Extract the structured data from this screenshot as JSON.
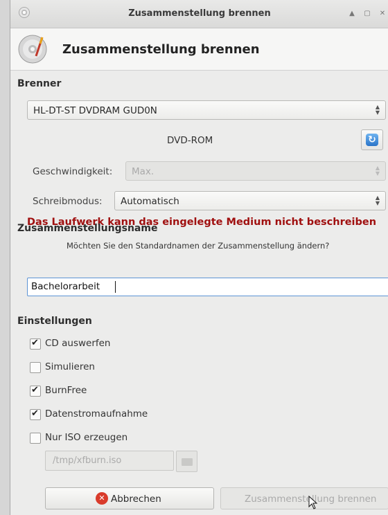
{
  "window": {
    "title": "Zusammenstellung brennen"
  },
  "header": {
    "title": "Zusammenstellung brennen"
  },
  "burner": {
    "section_label": "Brenner",
    "drive": "HL-DT-ST DVDRAM GUD0N",
    "media": "DVD-ROM",
    "speed_label": "Geschwindigkeit:",
    "speed_value": "Max.",
    "mode_label": "Schreibmodus:",
    "mode_value": "Automatisch",
    "error": "Das Laufwerk kann das eingelegte Medium nicht beschreiben"
  },
  "composition": {
    "section_label": "Zusammenstellungsname",
    "hint": "Möchten Sie den Standardnamen der Zusammenstellung ändern?",
    "name": "Bachelorarbeit"
  },
  "settings": {
    "section_label": "Einstellungen",
    "options": [
      {
        "label": "CD auswerfen",
        "checked": true
      },
      {
        "label": "Simulieren",
        "checked": false
      },
      {
        "label": "BurnFree",
        "checked": true
      },
      {
        "label": "Datenstromaufnahme",
        "checked": true
      },
      {
        "label": "Nur ISO erzeugen",
        "checked": false
      }
    ],
    "iso_path": "/tmp/xfburn.iso"
  },
  "buttons": {
    "cancel": "Abbrechen",
    "burn": "Zusammenstellung brennen"
  },
  "colors": {
    "error": "#a01010",
    "accent": "#2a74c8",
    "cancel_icon": "#d93b2b"
  }
}
